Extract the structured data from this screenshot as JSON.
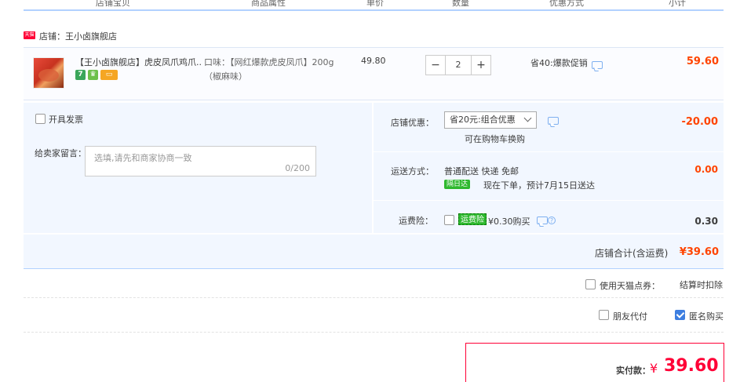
{
  "header": {
    "cols": [
      "店铺宝贝",
      "商品属性",
      "单价",
      "数量",
      "优惠方式",
      "小计"
    ]
  },
  "shop": {
    "badge": "天猫",
    "name": "店铺：王小卤旗舰店"
  },
  "item": {
    "title": "【王小卤旗舰店】虎皮凤爪鸡爪...",
    "attr": "口味：【网红爆款虎皮凤爪】200g（椒麻味）",
    "price": "49.80",
    "quantity": "2",
    "minus": "−",
    "plus": "+",
    "promo": "省40:爆款促销",
    "subtotal": "59.60",
    "service_icons": [
      "7",
      "♛",
      "▭"
    ]
  },
  "options": {
    "invoice_label": "开具发票",
    "message_label": "给卖家留言：",
    "message_placeholder": "选填,请先和商家协商一致",
    "message_count": "0/200"
  },
  "shop_discount": {
    "label": "店铺优惠：",
    "selected": "省20元:组合优惠",
    "hint": "可在购物车换购",
    "amount": "-20.00"
  },
  "shipping": {
    "label": "运送方式：",
    "method": "普通配送 快递 免邮",
    "tag": "隔日达",
    "eta": "现在下单，预计7月15日送达",
    "amount": "0.00"
  },
  "insurance": {
    "label": "运费险：",
    "tag": "运费险",
    "price": "¥0.30购买",
    "amount": "0.30"
  },
  "shop_total": {
    "label": "店铺合计(含运费)",
    "amount": "¥39.60"
  },
  "points": {
    "label": "使用天猫点券：",
    "note": "结算时扣除"
  },
  "friend_pay": {
    "label": "朋友代付"
  },
  "anonymous": {
    "label": "匿名购买"
  },
  "payment": {
    "label": "实付款：",
    "currency": "¥",
    "amount": "39.60"
  },
  "colors": {
    "accent_red": "#ff0036",
    "price_orange": "#ff4400",
    "light_blue_bg": "#f2f7ff",
    "check_blue": "#3d7ee0"
  }
}
